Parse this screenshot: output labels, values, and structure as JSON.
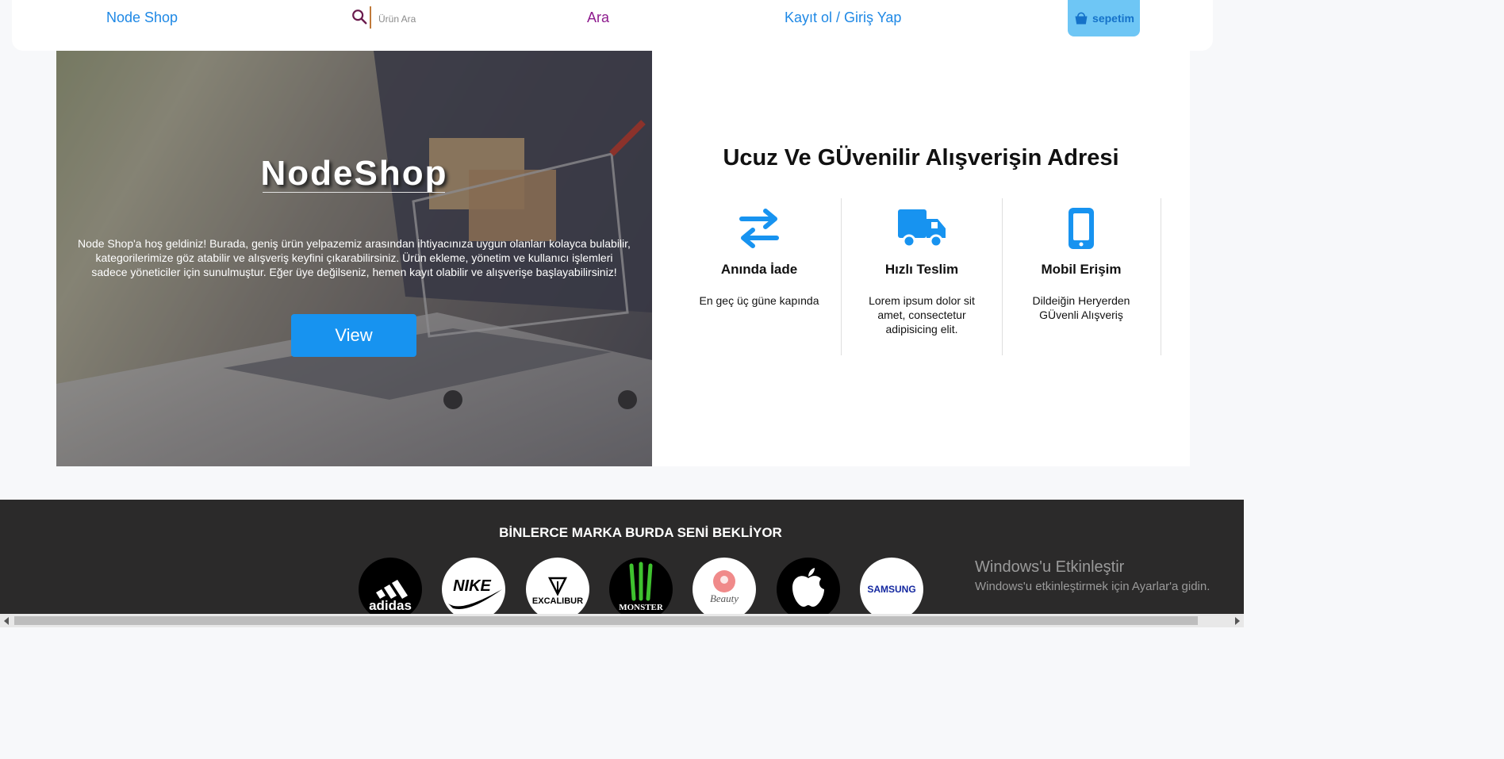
{
  "navbar": {
    "brand": "Node Shop",
    "search_placeholder": "Ürün Ara",
    "search_button": "Ara",
    "auth_link": "Kayıt ol / Giriş Yap",
    "cart_label": "sepetim"
  },
  "hero": {
    "title": "NodeShop",
    "text": "Node Shop'a hoş geldiniz! Burada, geniş ürün yelpazemiz arasından ihtiyacınıza uygun olanları kolayca bulabilir, kategorilerimize göz atabilir ve alışveriş keyfini çıkarabilirsiniz. Ürün ekleme, yönetim ve kullanıcı işlemleri sadece yöneticiler için sunulmuştur. Eğer üye değilseniz, hemen kayıt olabilir ve alışverişe başlayabilirsiniz!",
    "button": "View"
  },
  "features": {
    "title": "Ucuz Ve GÜvenilir Alışverişin Adresi",
    "items": [
      {
        "icon": "exchange-icon",
        "title": "Anında İade",
        "text": "En geç üç güne kapında"
      },
      {
        "icon": "truck-icon",
        "title": "Hızlı Teslim",
        "text": "Lorem ipsum dolor sit amet, consectetur adipisicing elit."
      },
      {
        "icon": "mobile-icon",
        "title": "Mobil Erişim",
        "text": "Dildeiğin Heryerden GÜvenli Alışveriş"
      }
    ]
  },
  "brands": {
    "title": "BİNLERCE MARKA BURDA SENİ BEKLİYOR",
    "items": [
      {
        "name": "adidas",
        "label": "adidas"
      },
      {
        "name": "nike",
        "label": "NIKE"
      },
      {
        "name": "excalibur",
        "label": "EXCALIBUR"
      },
      {
        "name": "monster",
        "label": "MONSTER"
      },
      {
        "name": "beauty",
        "label": "Beauty"
      },
      {
        "name": "apple",
        "label": ""
      },
      {
        "name": "samsung",
        "label": "SAMSUNG"
      }
    ]
  },
  "windows_activation": {
    "title": "Windows'u Etkinleştir",
    "subtitle": "Windows'u etkinleştirmek için Ayarlar'a gidin."
  },
  "colors": {
    "accent": "#1793f0",
    "link": "#1e88e5",
    "search_button": "#8e1b8e",
    "cart_bg": "#6ec6f5",
    "footer_bg": "#2b2a2a"
  }
}
